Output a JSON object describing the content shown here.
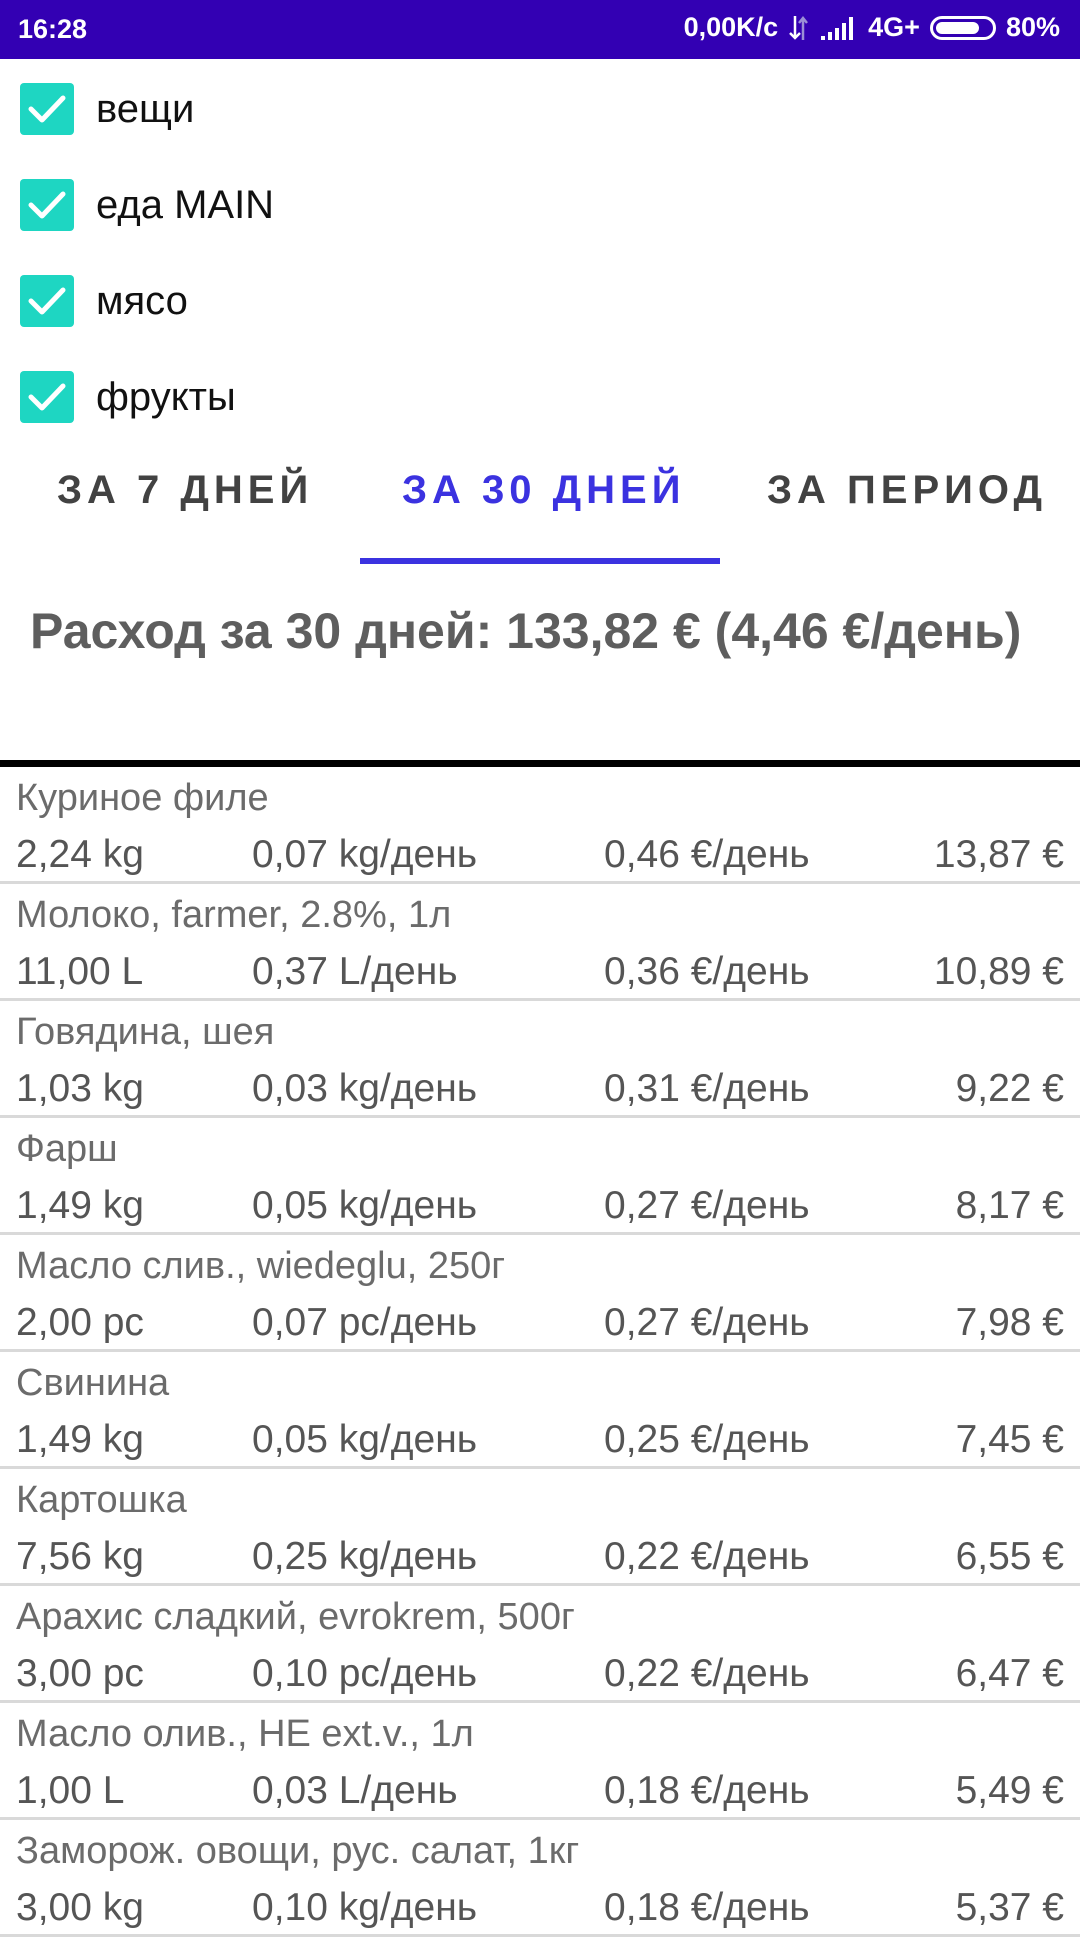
{
  "status_bar": {
    "time": "16:28",
    "net_speed": "0,00K/с",
    "network": "4G+",
    "battery": "80%",
    "battery_level": 0.8
  },
  "categories": [
    {
      "label": "вещи",
      "checked": true
    },
    {
      "label": "еда MAIN",
      "checked": true
    },
    {
      "label": "мясо",
      "checked": true
    },
    {
      "label": "фрукты",
      "checked": true
    }
  ],
  "tabs": [
    {
      "label": "ЗА 7 ДНЕЙ",
      "active": false
    },
    {
      "label": "ЗА 30 ДНЕЙ",
      "active": true
    },
    {
      "label": "ЗА ПЕРИОД",
      "active": false
    }
  ],
  "summary": "Расход за 30 дней: 133,82 € (4,46 €/день)",
  "items": [
    {
      "name": "Куриное филе",
      "qty": "2,24 kg",
      "rate": "0,07 kg/день",
      "eur_rate": "0,46 €/день",
      "total": "13,87 €"
    },
    {
      "name": "Молоко, farmer, 2.8%, 1л",
      "qty": "11,00 L",
      "rate": "0,37 L/день",
      "eur_rate": "0,36 €/день",
      "total": "10,89 €"
    },
    {
      "name": "Говядина, шея",
      "qty": "1,03 kg",
      "rate": "0,03 kg/день",
      "eur_rate": "0,31 €/день",
      "total": "9,22 €"
    },
    {
      "name": "Фарш",
      "qty": "1,49 kg",
      "rate": "0,05 kg/день",
      "eur_rate": "0,27 €/день",
      "total": "8,17 €"
    },
    {
      "name": "Масло слив., wiedeglu, 250г",
      "qty": "2,00 pc",
      "rate": "0,07 pc/день",
      "eur_rate": "0,27 €/день",
      "total": "7,98 €"
    },
    {
      "name": "Свинина",
      "qty": "1,49 kg",
      "rate": "0,05 kg/день",
      "eur_rate": "0,25 €/день",
      "total": "7,45 €"
    },
    {
      "name": "Картошка",
      "qty": "7,56 kg",
      "rate": "0,25 kg/день",
      "eur_rate": "0,22 €/день",
      "total": "6,55 €"
    },
    {
      "name": "Арахис сладкий, evrokrem, 500г",
      "qty": "3,00 pc",
      "rate": "0,10 pc/день",
      "eur_rate": "0,22 €/день",
      "total": "6,47 €"
    },
    {
      "name": "Масло олив., HE ext.v., 1л",
      "qty": "1,00 L",
      "rate": "0,03 L/день",
      "eur_rate": "0,18 €/день",
      "total": "5,49 €"
    },
    {
      "name": "Заморож. овощи, рус. салат, 1кг",
      "qty": "3,00 kg",
      "rate": "0,10 kg/день",
      "eur_rate": "0,18 €/день",
      "total": "5,37 €"
    }
  ]
}
